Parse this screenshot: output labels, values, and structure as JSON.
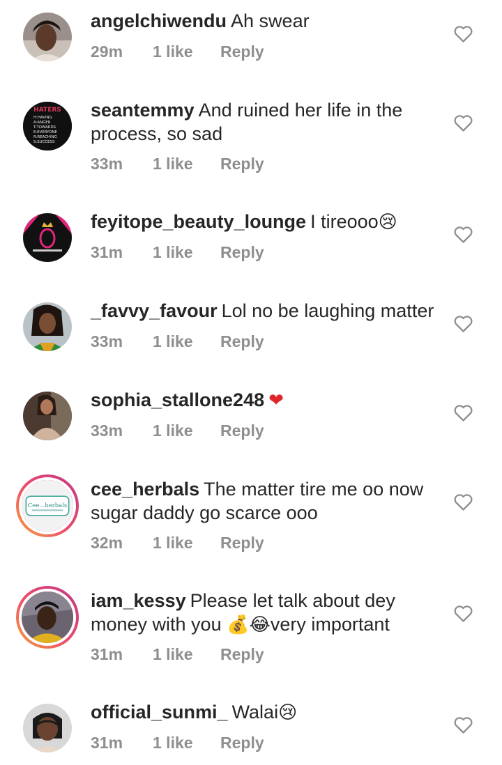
{
  "comments": [
    {
      "username": "angelchiwendu",
      "text_lines": [
        "Ah swear"
      ],
      "time": "29m",
      "likes": "1 like",
      "reply": "Reply"
    },
    {
      "username": "seantemmy",
      "text_lines": [
        "And ruined her life in the",
        "process, so sad"
      ],
      "time": "33m",
      "likes": "1 like",
      "reply": "Reply",
      "avatar_text": [
        "HATERS",
        "H:HAVING",
        "A:ANGER",
        "T:TOWARDS",
        "E:EVERYONE",
        "R:REACHING",
        "S:SUCCESS"
      ]
    },
    {
      "username": "feyitope_beauty_lounge",
      "text_lines": [
        "I tireooo"
      ],
      "emoji": "😢",
      "time": "31m",
      "likes": "1 like",
      "reply": "Reply"
    },
    {
      "username": "_favvy_favour",
      "text_lines": [
        "Lol no be laughing matter"
      ],
      "time": "33m",
      "likes": "1 like",
      "reply": "Reply"
    },
    {
      "username": "sophia_stallone248",
      "text_lines": [
        ""
      ],
      "emoji": "❤",
      "time": "33m",
      "likes": "1 like",
      "reply": "Reply"
    },
    {
      "username": "cee_herbals",
      "text_lines": [
        "The matter tire me oo now",
        "sugar daddy go scarce ooo"
      ],
      "time": "32m",
      "likes": "1 like",
      "reply": "Reply",
      "avatar_text": [
        "Cee...herbals"
      ]
    },
    {
      "username": "iam_kessy",
      "text_lines": [
        "Please let talk about dey",
        "money with you",
        "very important"
      ],
      "emoji_a": "💰",
      "emoji_b": "😂",
      "time": "31m",
      "likes": "1 like",
      "reply": "Reply"
    },
    {
      "username": "official_sunmi_",
      "text_lines": [
        "Walai"
      ],
      "emoji": "😢",
      "time": "31m",
      "likes": "1 like",
      "reply": "Reply"
    }
  ],
  "colors": {
    "text": "#262626",
    "meta": "#8e8e8e",
    "heart_outline": "#8e8e8e",
    "red_heart": "#e0262a",
    "story_ring_start": "#f9a13a",
    "story_ring_end": "#c13584"
  },
  "icons": {
    "like": "heart-outline-icon"
  }
}
